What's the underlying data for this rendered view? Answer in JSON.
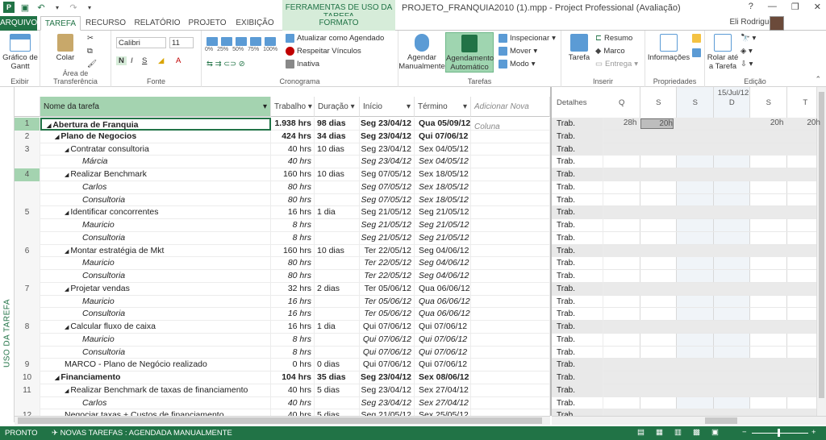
{
  "app": {
    "title": "PROJETO_FRANQUIA2010 (1).mpp - Project Professional (Avaliação)",
    "context_title": "FERRAMENTAS DE USO DA TAREFA",
    "user": "Eli Rodrigues"
  },
  "tabs": [
    "ARQUIVO",
    "TAREFA",
    "RECURSO",
    "RELATÓRIO",
    "PROJETO",
    "EXIBIÇÃO",
    "FORMATO"
  ],
  "ribbon": {
    "groups": [
      "Exibir",
      "Área de Transferência",
      "Fonte",
      "Cronograma",
      "Tarefas",
      "Inserir",
      "Propriedades",
      "Edição"
    ],
    "gantt": "Gráfico de Gantt",
    "paste": "Colar",
    "font_name": "Calibri",
    "font_size": "11",
    "bold": "N",
    "italic": "I",
    "underline": "S",
    "sched_update": "Atualizar como Agendado",
    "sched_links": "Respeitar Vínculos",
    "sched_inactive": "Inativa",
    "manual": "Agendar Manualmente",
    "auto": "Agendamento Automático",
    "inspect": "Inspecionar",
    "move": "Mover",
    "mode": "Modo",
    "task": "Tarefa",
    "summary": "Resumo",
    "milestone": "Marco",
    "deliverable": "Entrega",
    "info": "Informações",
    "scroll": "Rolar até a Tarefa",
    "pct": [
      "0%",
      "25%",
      "50%",
      "75%",
      "100%"
    ]
  },
  "side_label": "USO DA TAREFA",
  "columns": [
    "Nome da tarefa",
    "Trabalho",
    "Duração",
    "Início",
    "Término",
    "Adicionar Nova Coluna"
  ],
  "usage": {
    "details": "Detalhes",
    "date": "15/Jul/12",
    "days": [
      "Q",
      "S",
      "S",
      "D",
      "S",
      "T"
    ],
    "row_label": "Trab.",
    "first_row": [
      "28h",
      "20h",
      "",
      "",
      "20h",
      "20h"
    ]
  },
  "rows": [
    {
      "id": "1",
      "name": "Abertura de Franquia",
      "work": "1.938 hrs",
      "dur": "98 dias",
      "start": "Seg 23/04/12",
      "end": "Qua 05/09/12",
      "lvl": 0,
      "type": "sum",
      "hl": true
    },
    {
      "id": "2",
      "name": "Plano de Negocios",
      "work": "424 hrs",
      "dur": "34 dias",
      "start": "Seg 23/04/12",
      "end": "Qui 07/06/12",
      "lvl": 1,
      "type": "sum"
    },
    {
      "id": "3",
      "name": "Contratar consultoria",
      "work": "40 hrs",
      "dur": "10 dias",
      "start": "Seg 23/04/12",
      "end": "Sex 04/05/12",
      "lvl": 2,
      "type": "task"
    },
    {
      "id": "",
      "name": "Márcia",
      "work": "40 hrs",
      "dur": "",
      "start": "Seg 23/04/12",
      "end": "Sex 04/05/12",
      "lvl": 3,
      "type": "res"
    },
    {
      "id": "4",
      "name": "Realizar Benchmark",
      "work": "160 hrs",
      "dur": "10 dias",
      "start": "Seg 07/05/12",
      "end": "Sex 18/05/12",
      "lvl": 2,
      "type": "task",
      "hl": true
    },
    {
      "id": "",
      "name": "Carlos",
      "work": "80 hrs",
      "dur": "",
      "start": "Seg 07/05/12",
      "end": "Sex 18/05/12",
      "lvl": 3,
      "type": "res"
    },
    {
      "id": "",
      "name": "Consultoria",
      "work": "80 hrs",
      "dur": "",
      "start": "Seg 07/05/12",
      "end": "Sex 18/05/12",
      "lvl": 3,
      "type": "res"
    },
    {
      "id": "5",
      "name": "Identificar concorrentes",
      "work": "16 hrs",
      "dur": "1 dia",
      "start": "Seg 21/05/12",
      "end": "Seg 21/05/12",
      "lvl": 2,
      "type": "task"
    },
    {
      "id": "",
      "name": "Mauricio",
      "work": "8 hrs",
      "dur": "",
      "start": "Seg 21/05/12",
      "end": "Seg 21/05/12",
      "lvl": 3,
      "type": "res"
    },
    {
      "id": "",
      "name": "Consultoria",
      "work": "8 hrs",
      "dur": "",
      "start": "Seg 21/05/12",
      "end": "Seg 21/05/12",
      "lvl": 3,
      "type": "res"
    },
    {
      "id": "6",
      "name": "Montar estratégia de Mkt",
      "work": "160 hrs",
      "dur": "10 dias",
      "start": "Ter 22/05/12",
      "end": "Seg 04/06/12",
      "lvl": 2,
      "type": "task"
    },
    {
      "id": "",
      "name": "Mauricio",
      "work": "80 hrs",
      "dur": "",
      "start": "Ter 22/05/12",
      "end": "Seg 04/06/12",
      "lvl": 3,
      "type": "res"
    },
    {
      "id": "",
      "name": "Consultoria",
      "work": "80 hrs",
      "dur": "",
      "start": "Ter 22/05/12",
      "end": "Seg 04/06/12",
      "lvl": 3,
      "type": "res"
    },
    {
      "id": "7",
      "name": "Projetar vendas",
      "work": "32 hrs",
      "dur": "2 dias",
      "start": "Ter 05/06/12",
      "end": "Qua 06/06/12",
      "lvl": 2,
      "type": "task"
    },
    {
      "id": "",
      "name": "Mauricio",
      "work": "16 hrs",
      "dur": "",
      "start": "Ter 05/06/12",
      "end": "Qua 06/06/12",
      "lvl": 3,
      "type": "res"
    },
    {
      "id": "",
      "name": "Consultoria",
      "work": "16 hrs",
      "dur": "",
      "start": "Ter 05/06/12",
      "end": "Qua 06/06/12",
      "lvl": 3,
      "type": "res"
    },
    {
      "id": "8",
      "name": "Calcular fluxo de caixa",
      "work": "16 hrs",
      "dur": "1 dia",
      "start": "Qui 07/06/12",
      "end": "Qui 07/06/12",
      "lvl": 2,
      "type": "task"
    },
    {
      "id": "",
      "name": "Mauricio",
      "work": "8 hrs",
      "dur": "",
      "start": "Qui 07/06/12",
      "end": "Qui 07/06/12",
      "lvl": 3,
      "type": "res"
    },
    {
      "id": "",
      "name": "Consultoria",
      "work": "8 hrs",
      "dur": "",
      "start": "Qui 07/06/12",
      "end": "Qui 07/06/12",
      "lvl": 3,
      "type": "res"
    },
    {
      "id": "9",
      "name": "MARCO - Plano de Negócio realizado",
      "work": "0 hrs",
      "dur": "0 dias",
      "start": "Qui 07/06/12",
      "end": "Qui 07/06/12",
      "lvl": 2,
      "type": "ms"
    },
    {
      "id": "10",
      "name": "Financiamento",
      "work": "104 hrs",
      "dur": "35 dias",
      "start": "Seg 23/04/12",
      "end": "Sex 08/06/12",
      "lvl": 1,
      "type": "sum"
    },
    {
      "id": "11",
      "name": "Realizar Benchmark de taxas de financiamento",
      "work": "40 hrs",
      "dur": "5 dias",
      "start": "Seg 23/04/12",
      "end": "Sex 27/04/12",
      "lvl": 2,
      "type": "task"
    },
    {
      "id": "",
      "name": "Carlos",
      "work": "40 hrs",
      "dur": "",
      "start": "Seg 23/04/12",
      "end": "Sex 27/04/12",
      "lvl": 3,
      "type": "res"
    },
    {
      "id": "12",
      "name": "Negociar taxas + Custos de financiamento",
      "work": "40 hrs",
      "dur": "5 dias",
      "start": "Seg 21/05/12",
      "end": "Sex 25/05/12",
      "lvl": 2,
      "type": "task"
    }
  ],
  "status": {
    "ready": "PRONTO",
    "new_tasks": "NOVAS TAREFAS : AGENDADA MANUALMENTE"
  }
}
